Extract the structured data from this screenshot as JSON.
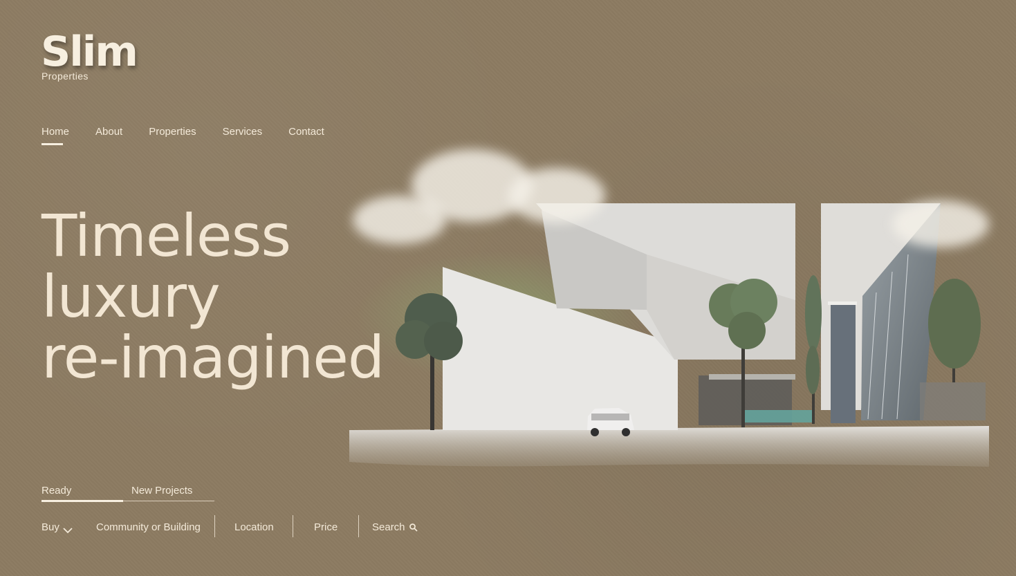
{
  "brand": {
    "name": "Slim",
    "subtitle": "Properties"
  },
  "nav": {
    "items": [
      {
        "label": "Home",
        "active": true
      },
      {
        "label": "About",
        "active": false
      },
      {
        "label": "Properties",
        "active": false
      },
      {
        "label": "Services",
        "active": false
      },
      {
        "label": "Contact",
        "active": false
      }
    ]
  },
  "hero": {
    "title_lines": [
      "Timeless",
      "luxury",
      "re-imagined"
    ]
  },
  "filter_tabs": [
    {
      "label": "Ready",
      "active": true
    },
    {
      "label": "New Projects",
      "active": false
    }
  ],
  "search": {
    "mode_label": "Buy",
    "community_label": "Community or Building",
    "location_label": "Location",
    "price_label": "Price",
    "search_label": "Search"
  },
  "icons": {
    "dropdown": "chevron-down-icon",
    "search": "search-icon"
  },
  "colors": {
    "background": "#8c7b62",
    "text": "#f4ead9",
    "accent": "#f7efe0"
  }
}
